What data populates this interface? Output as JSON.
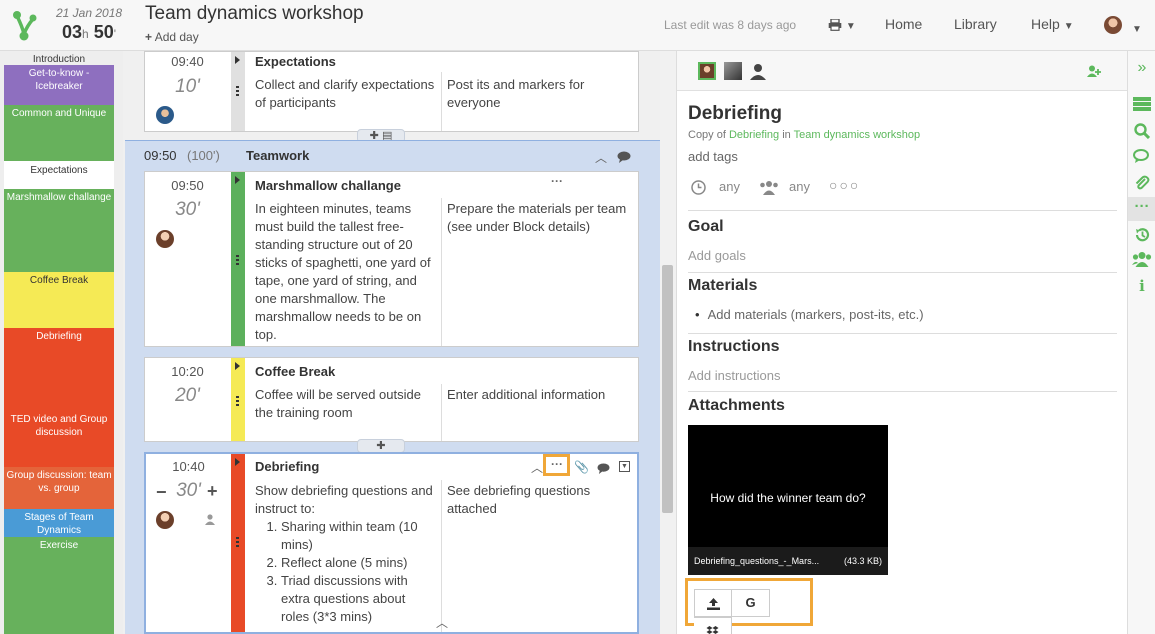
{
  "header": {
    "date": "21 Jan 2018",
    "duration_h": "03",
    "duration_h_unit": "h",
    "duration_m": "50",
    "duration_m_unit": "'",
    "title": "Team dynamics workshop",
    "add_day": "Add day",
    "last_edit": "Last edit was 8 days ago",
    "nav": {
      "home": "Home",
      "library": "Library",
      "help": "Help"
    }
  },
  "sidebar": {
    "blocks": [
      {
        "label": "Introduction",
        "color": "#eeeeee"
      },
      {
        "label": "Get-to-know - Icebreaker",
        "color": "#8e6fbf"
      },
      {
        "label": "Common and Unique",
        "color": "#67b15c"
      },
      {
        "label": "Expectations",
        "color": "#ffffff"
      },
      {
        "label": "Marshmallow challange",
        "color": "#67b15c"
      },
      {
        "label": "Coffee Break",
        "color": "#f5ea55"
      },
      {
        "label": "Debriefing",
        "color": "#e84a27"
      },
      {
        "label": "TED video and Group discussion",
        "color": "#e84a27"
      },
      {
        "label": "Group discussion: team vs. group",
        "color": "#e4643a"
      },
      {
        "label": "Stages of Team Dynamics",
        "color": "#4a9bd6"
      },
      {
        "label": "Exercise",
        "color": "#67b15c"
      }
    ]
  },
  "schedule": {
    "expectations": {
      "time": "09:40",
      "duration": "10'",
      "title": "Expectations",
      "desc": "Collect and clarify expectations of participants",
      "notes": "Post its and markers for everyone",
      "color": "#e0e0e0"
    },
    "group": {
      "time": "09:50",
      "duration": "(100')",
      "name": "Teamwork"
    },
    "marshmallow": {
      "time": "09:50",
      "duration": "30'",
      "title": "Marshmallow challange",
      "desc": "In eighteen minutes, teams must build the tallest free-standing structure out of 20 sticks of spaghetti, one yard of tape, one yard of string, and one marshmallow. The marshmallow needs to be on top.",
      "notes": "Prepare the materials per team (see under Block details)",
      "color": "#5cb05c"
    },
    "coffee": {
      "time": "10:20",
      "duration": "20'",
      "title": "Coffee Break",
      "desc": "Coffee will be served outside the training room",
      "notes_placeholder": "Enter additional information",
      "color": "#f5ea55"
    },
    "debriefing": {
      "time": "10:40",
      "duration": "30'",
      "title": "Debriefing",
      "desc_intro": "Show debriefing questions and instruct to:",
      "steps": [
        "Sharing within team (10 mins)",
        "Reflect alone (5 mins)",
        "Triad discussions with extra questions about roles (3*3 mins)"
      ],
      "notes": "See debriefing questions attached",
      "color": "#e84a27"
    }
  },
  "details": {
    "title": "Debriefing",
    "copy_prefix": "Copy of",
    "copy_block": "Debriefing",
    "copy_in": "in",
    "copy_workshop": "Team dynamics workshop",
    "add_tags": "add tags",
    "time_any": "any",
    "people_any": "any",
    "goal_h": "Goal",
    "goal_ph": "Add goals",
    "materials_h": "Materials",
    "materials_ph": "Add materials (markers, post-its, etc.)",
    "instructions_h": "Instructions",
    "instructions_ph": "Add instructions",
    "attachments_h": "Attachments",
    "attachment": {
      "preview_text": "How did the winner team do?",
      "file_name": "Debriefing_questions_-_Mars...",
      "file_size": "(43.3 KB)"
    },
    "upload_google": "G"
  },
  "colors": {
    "accent": "#5cb85c",
    "highlight": "#f0a738"
  }
}
